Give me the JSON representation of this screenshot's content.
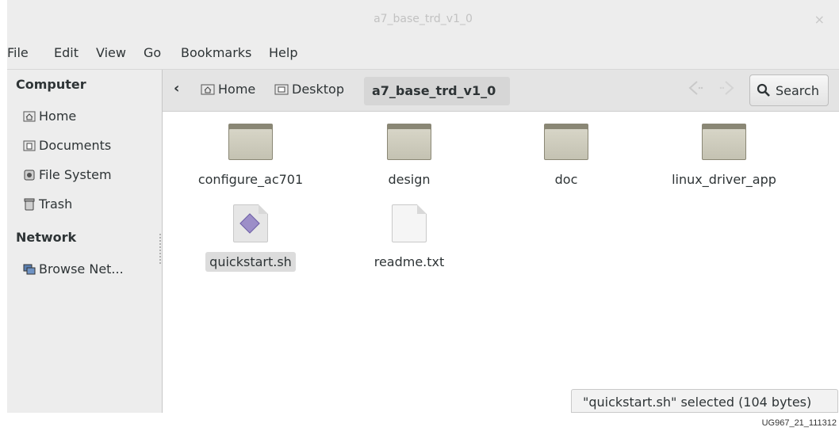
{
  "window": {
    "title": "a7_base_trd_v1_0",
    "close_glyph": "×"
  },
  "menubar": {
    "items": [
      "File",
      "Edit",
      "View",
      "Go",
      "Bookmarks",
      "Help"
    ]
  },
  "sidebar": {
    "computer_heading": "Computer",
    "computer_items": [
      {
        "label": "Home",
        "icon": "home-icon"
      },
      {
        "label": "Documents",
        "icon": "documents-icon"
      },
      {
        "label": "File System",
        "icon": "file-system-icon"
      },
      {
        "label": "Trash",
        "icon": "trash-icon"
      }
    ],
    "network_heading": "Network",
    "network_items": [
      {
        "label": "Browse Net...",
        "icon": "network-icon"
      }
    ]
  },
  "pathbar": {
    "back_glyph": "‹",
    "crumbs": [
      "Home",
      "Desktop"
    ],
    "current": "a7_base_trd_v1_0",
    "search_label": "Search"
  },
  "files": [
    {
      "name": "configure_ac701",
      "type": "folder"
    },
    {
      "name": "design",
      "type": "folder"
    },
    {
      "name": "doc",
      "type": "folder"
    },
    {
      "name": "linux_driver_app",
      "type": "folder"
    },
    {
      "name": "quickstart.sh",
      "type": "script",
      "selected": true
    },
    {
      "name": "readme.txt",
      "type": "text"
    }
  ],
  "status": "\"quickstart.sh\" selected (104 bytes)",
  "figure_id": "UG967_21_111312",
  "colors": {
    "accent_selection": "#dcdcdc",
    "chrome": "#ededed",
    "folder": "#c4c2b2"
  }
}
